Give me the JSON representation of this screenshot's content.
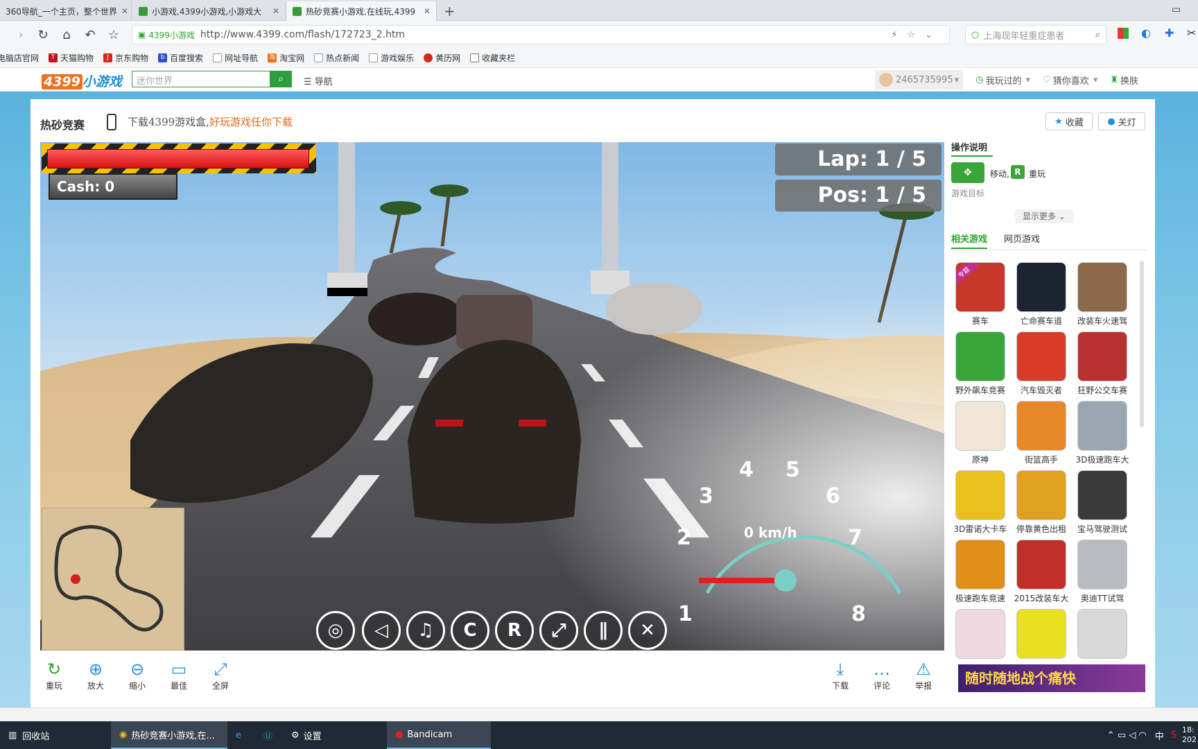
{
  "browser": {
    "tabs": [
      {
        "label": "360导航_一个主页，整个世界",
        "active": false
      },
      {
        "label": "小游戏,4399小游戏,小游戏大",
        "active": false
      },
      {
        "label": "热砂竞赛小游戏,在线玩,4399",
        "active": true
      }
    ],
    "new_tab": "+",
    "site_badge": "4399小游戏",
    "url": "http://www.4399.com/flash/172723_2.htm",
    "search_placeholder": "上海现年轻重症患者",
    "bookmarks": [
      "电脑店官网",
      "天猫购物",
      "京东购物",
      "百度搜索",
      "网址导航",
      "淘宝网",
      "热点新闻",
      "游戏娱乐",
      "黄历网",
      "收藏夹栏"
    ]
  },
  "site": {
    "logo_num": "4399",
    "logo_text": "小游戏",
    "search_placeholder": "迷你世界",
    "nav_label": "☰ 导航",
    "user_id": "2465735995",
    "played": "我玩过的",
    "guess": "猜你喜欢",
    "skin": "换肤"
  },
  "game": {
    "title": "热砂竞赛",
    "download_text": "下载4399游戏盒,",
    "download_highlight": "好玩游戏任你下载",
    "favorite": "收藏",
    "lights_off": "关灯",
    "hud": {
      "cash": "Cash: 0",
      "lap": "Lap: 1 / 5",
      "pos": "Pos: 1 / 5",
      "speed": "0 km/h",
      "health_fraction": 1.0,
      "gauge_ticks": [
        "1",
        "2",
        "3",
        "4",
        "5",
        "6",
        "7",
        "8"
      ]
    },
    "controls": [
      "gamepad",
      "sound",
      "music",
      "C",
      "R",
      "fullscreen",
      "pause",
      "close"
    ],
    "toolbar_left": [
      {
        "icon": "↻",
        "label": "重玩"
      },
      {
        "icon": "⊕",
        "label": "放大"
      },
      {
        "icon": "⊖",
        "label": "缩小"
      },
      {
        "icon": "▭",
        "label": "最佳"
      },
      {
        "icon": "⤢",
        "label": "全屏"
      }
    ],
    "toolbar_right": [
      {
        "icon": "⤓",
        "label": "下载"
      },
      {
        "icon": "…",
        "label": "评论"
      },
      {
        "icon": "⚠",
        "label": "举报"
      }
    ]
  },
  "right_panel": {
    "instructions_title": "操作说明",
    "move_label": "移动,",
    "replay_key": "R",
    "replay_label": "重玩",
    "goal_label": "游戏目标",
    "show_more": "显示更多",
    "tabs": [
      "相关游戏",
      "网页游戏"
    ],
    "games": [
      {
        "name": "赛车",
        "color": "#c8382a",
        "badge": "专题"
      },
      {
        "name": "亡命赛车道",
        "color": "#1c2430"
      },
      {
        "name": "改装车火速驾",
        "color": "#8a6a4a"
      },
      {
        "name": "野外飙车竞赛",
        "color": "#3aa53a"
      },
      {
        "name": "汽车毁灭者",
        "color": "#d83c28"
      },
      {
        "name": "狂野公交车赛",
        "color": "#b83030"
      },
      {
        "name": "原神",
        "color": "#f0e6d8"
      },
      {
        "name": "街篮高手",
        "color": "#e8862a"
      },
      {
        "name": "3D极速跑车大",
        "color": "#9aa6b2"
      },
      {
        "name": "3D雷诺大卡车",
        "color": "#e8c020"
      },
      {
        "name": "停靠黄色出租",
        "color": "#e0a020"
      },
      {
        "name": "宝马驾驶测试",
        "color": "#3a3a3a"
      },
      {
        "name": "极速跑车竞速",
        "color": "#e09018"
      },
      {
        "name": "2015改装车大",
        "color": "#c03028"
      },
      {
        "name": "奥迪TT试驾",
        "color": "#b8bcc0"
      },
      {
        "name": "",
        "color": "#f0d8e0"
      },
      {
        "name": "",
        "color": "#e8e020"
      },
      {
        "name": "",
        "color": "#d8d8d8"
      }
    ],
    "ad_text": "随时随地战个痛快"
  },
  "taskbar": {
    "items": [
      "回收站",
      "热砂竞赛小游戏,在...",
      "设置",
      "Bandicam"
    ],
    "tray": [
      "中"
    ],
    "clock": "18:",
    "date": "202"
  }
}
